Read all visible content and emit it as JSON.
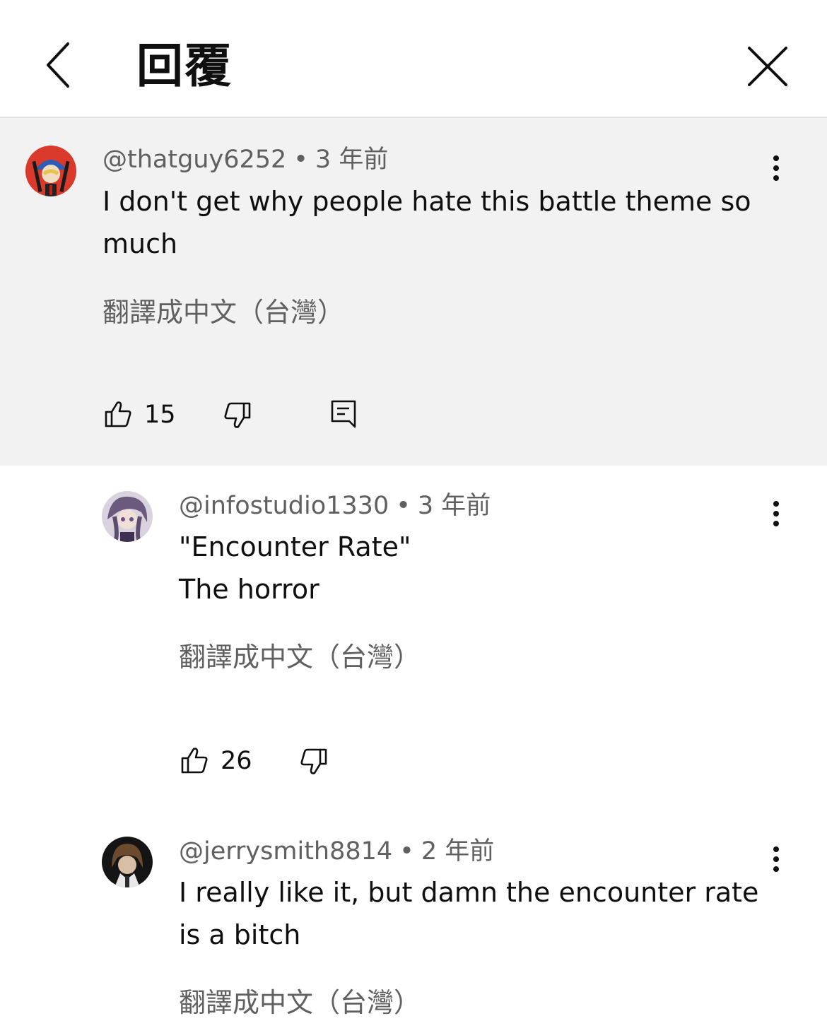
{
  "header": {
    "title": "回覆"
  },
  "comments": [
    {
      "author": "@thatguy6252",
      "separator": "•",
      "time": "3 年前",
      "text_lines": [
        "I don't get why people hate this battle theme so",
        "much"
      ],
      "translate_label": "翻譯成中文（台灣）",
      "likes": "15"
    },
    {
      "author": "@infostudio1330",
      "separator": "•",
      "time": "3 年前",
      "text_lines": [
        "\"Encounter Rate\"",
        "The horror"
      ],
      "translate_label": "翻譯成中文（台灣）",
      "likes": "26"
    },
    {
      "author": "@jerrysmith8814",
      "separator": "•",
      "time": "2 年前",
      "text_lines": [
        "I really like it, but damn the encounter rate",
        "is a bitch"
      ],
      "translate_label": "翻譯成中文（台灣）"
    }
  ],
  "icons": {
    "back": "chevron-left-icon",
    "close": "close-icon",
    "more": "more-vert-icon",
    "like": "thumb-up-icon",
    "dislike": "thumb-down-icon",
    "reply": "reply-icon"
  },
  "colors": {
    "highlight_bg": "#f2f2f2",
    "secondary_text": "#606060",
    "primary_text": "#0f0f0f"
  }
}
